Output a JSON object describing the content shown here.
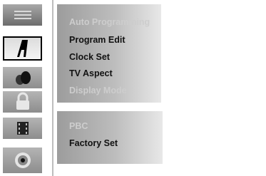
{
  "sidebar": {
    "items": [
      {
        "name": "general-menu-icon"
      },
      {
        "name": "language-icon"
      },
      {
        "name": "audio-icon"
      },
      {
        "name": "lock-icon"
      },
      {
        "name": "recording-icon"
      },
      {
        "name": "disc-icon"
      }
    ]
  },
  "menu": {
    "group1": [
      {
        "label": "Auto Programming",
        "state": "disabled"
      },
      {
        "label": "Program Edit",
        "state": "enabled"
      },
      {
        "label": "Clock Set",
        "state": "enabled"
      },
      {
        "label": "TV Aspect",
        "state": "enabled"
      },
      {
        "label": "Display Mode",
        "state": "disabled"
      }
    ],
    "group2": [
      {
        "label": "PBC",
        "state": "disabled"
      },
      {
        "label": "Factory Set",
        "state": "enabled"
      }
    ]
  }
}
